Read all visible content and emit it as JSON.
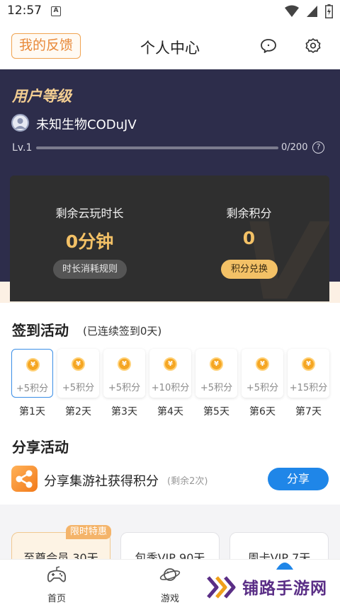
{
  "status_bar": {
    "time": "12:57",
    "indicator": "A"
  },
  "header": {
    "feedback_label": "我的反馈",
    "title": "个人中心",
    "icons": [
      "chat-bubble-icon",
      "settings-gear-icon"
    ]
  },
  "profile": {
    "section_title": "用户等级",
    "username": "未知生物CODuJV",
    "level_label": "Lv.1",
    "xp_text": "0/200",
    "xp_progress": 0,
    "help_glyph": "?"
  },
  "balance": {
    "time": {
      "label": "剩余云玩时长",
      "value": "0分钟",
      "button": "时长消耗规则"
    },
    "points": {
      "label": "剩余积分",
      "value": "0",
      "button": "积分兑换"
    },
    "watermark_glyph": "V"
  },
  "checkin": {
    "title": "签到活动",
    "subtitle": "(已连续签到0天)",
    "coin_glyph": "¥",
    "days": [
      {
        "label": "第1天",
        "points": "+5积分",
        "active": true
      },
      {
        "label": "第2天",
        "points": "+5积分",
        "active": false
      },
      {
        "label": "第3天",
        "points": "+5积分",
        "active": false
      },
      {
        "label": "第4天",
        "points": "+10积分",
        "active": false
      },
      {
        "label": "第5天",
        "points": "+5积分",
        "active": false
      },
      {
        "label": "第6天",
        "points": "+5积分",
        "active": false
      },
      {
        "label": "第7天",
        "points": "+15积分",
        "active": false
      }
    ]
  },
  "share": {
    "title": "分享活动",
    "text": "分享集游社获得积分",
    "remaining": "(剩余2次)",
    "button": "分享"
  },
  "vip": {
    "badge": "限时特惠",
    "cards": [
      "至尊会员 30天",
      "包季VIP 90天",
      "周卡VIP 7天"
    ]
  },
  "tabs": [
    {
      "label": "首页",
      "icon": "gamepad-icon"
    },
    {
      "label": "游戏",
      "icon": "planet-icon"
    }
  ],
  "watermark": {
    "text": "铺路手游网"
  },
  "colors": {
    "accent_blue": "#1f86e8",
    "gold": "#f3c166",
    "hero_bg": "#2d2d4b",
    "feedback_orange": "#e8893a"
  }
}
